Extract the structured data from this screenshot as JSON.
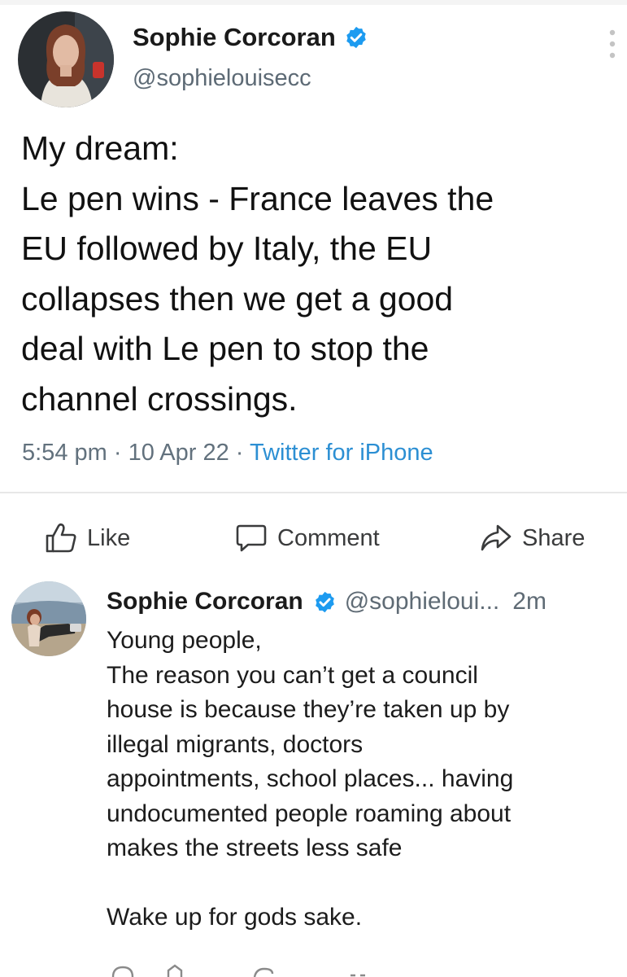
{
  "tweet": {
    "author_name": "Sophie Corcoran",
    "handle": "@sophielouisecc",
    "text_lines": [
      "My dream:",
      "Le pen wins - France leaves the",
      "EU followed by  Italy, the EU",
      "collapses then we get a good",
      "deal with Le pen to stop the",
      "channel crossings."
    ],
    "time": "5:54 pm",
    "date": "10 Apr 22",
    "source": "Twitter for iPhone"
  },
  "actions": {
    "like": "Like",
    "comment": "Comment",
    "share": "Share"
  },
  "reply": {
    "author_name": "Sophie Corcoran",
    "handle": "@sophieloui...",
    "time": "2m",
    "text_lines": [
      "Young people,",
      "The reason you can’t get a council",
      "house is because they’re taken up by",
      "illegal migrants, doctors",
      "appointments, school places... having",
      "undocumented people roaming about",
      "makes the streets less safe",
      "",
      "Wake up for gods sake."
    ]
  },
  "colors": {
    "verified": "#1d9bf0",
    "link": "#2c8fd3",
    "muted": "#62717d"
  },
  "icons": [
    "verified-badge-icon",
    "more-options-icon",
    "like-icon",
    "comment-icon",
    "share-icon"
  ]
}
